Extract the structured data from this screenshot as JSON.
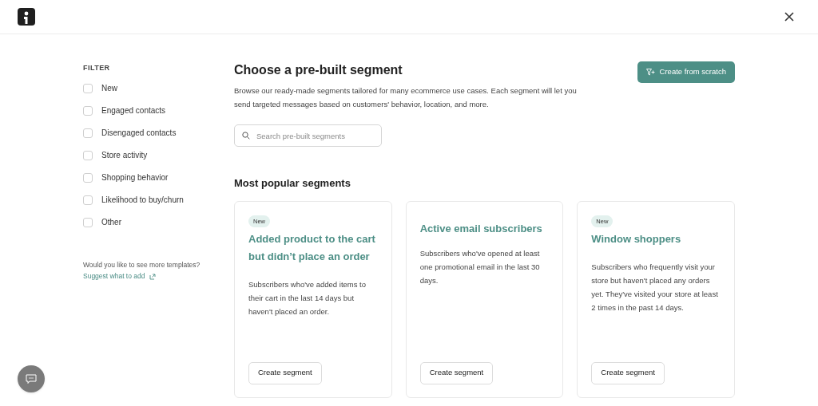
{
  "filter": {
    "title": "FILTER",
    "options": [
      {
        "label": "New",
        "checked": false
      },
      {
        "label": "Engaged contacts",
        "checked": false
      },
      {
        "label": "Disengaged contacts",
        "checked": false
      },
      {
        "label": "Store activity",
        "checked": false
      },
      {
        "label": "Shopping behavior",
        "checked": false
      },
      {
        "label": "Likelihood to buy/churn",
        "checked": false
      },
      {
        "label": "Other",
        "checked": false
      }
    ],
    "prompt": "Would you like to see more templates?",
    "link": "Suggest what to add"
  },
  "heading": "Choose a pre-built segment",
  "description": "Browse our ready-made segments tailored for many ecommerce use cases. Each segment will let you send targeted messages based on customers' behavior, location, and more.",
  "create_button": "Create from scratch",
  "search": {
    "placeholder": "Search pre-built segments"
  },
  "section_title": "Most popular segments",
  "cards": [
    {
      "badge": "New",
      "title": "Added product to the cart but didn’t place an order",
      "text": "Subscribers who've added items to their cart in the last 14 days but haven't placed an order.",
      "button": "Create segment"
    },
    {
      "title": "Active email subscribers",
      "text": "Subscribers who've opened at least one promotional email in the last 30 days.",
      "button": "Create segment"
    },
    {
      "badge": "New",
      "title": "Window shoppers",
      "text": "Subscribers who frequently visit your store but haven't placed any orders yet. They've visited your store at least 2 times in the past 14 days.",
      "button": "Create segment"
    }
  ]
}
